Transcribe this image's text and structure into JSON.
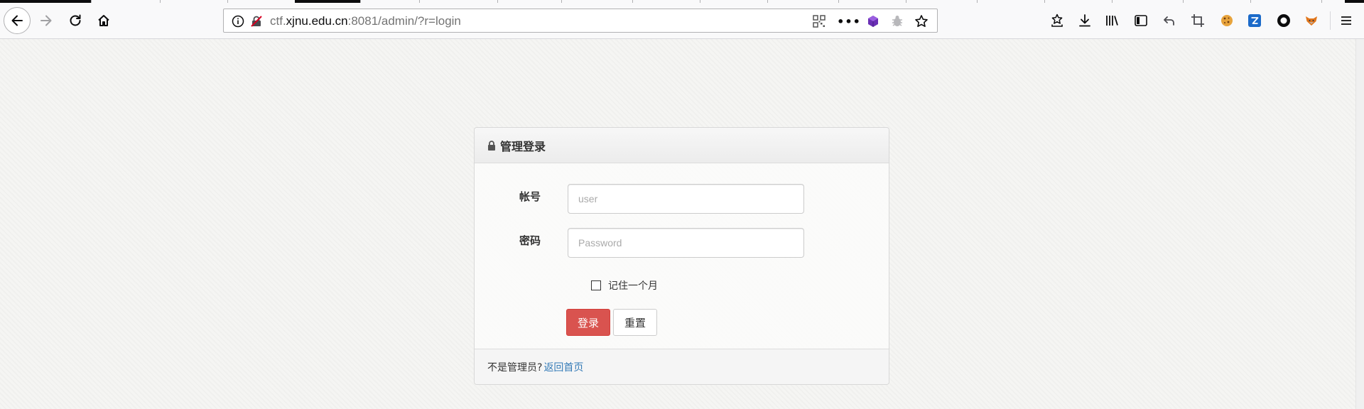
{
  "browser": {
    "url_prefix": "ctf.",
    "url_host": "xjnu.edu.cn",
    "url_suffix": ":8081/admin/?r=login",
    "page_actions_label": "•••"
  },
  "login": {
    "title": "管理登录",
    "username_label": "帐号",
    "username_placeholder": "user",
    "password_label": "密码",
    "password_placeholder": "Password",
    "remember_label": "记住一个月",
    "remember_checked": false,
    "login_button": "登录",
    "reset_button": "重置",
    "footer_text": "不是管理员?",
    "footer_link": "返回首页"
  },
  "colors": {
    "accent_danger": "#d9534f",
    "link": "#337ab7"
  }
}
